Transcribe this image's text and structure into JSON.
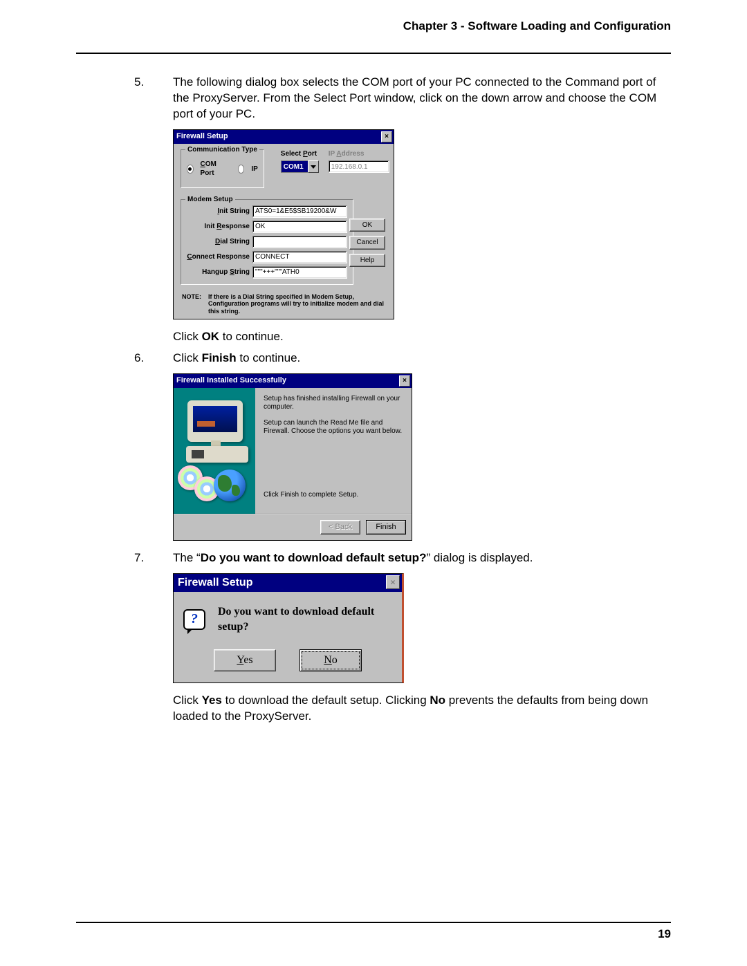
{
  "header": {
    "title": "Chapter 3 - Software Loading and Configuration"
  },
  "footer": {
    "page": "19"
  },
  "steps": {
    "s5": {
      "num": "5.",
      "text": "The following dialog box selects the COM port of your PC connected to the Command port of the ProxyServer. From the Select Port window, click on the down arrow and choose the COM port of your PC.",
      "after1_a": "Click ",
      "after1_b": "OK",
      "after1_c": " to continue."
    },
    "s6": {
      "num": "6.",
      "text_a": "Click ",
      "text_b": "Finish",
      "text_c": " to continue."
    },
    "s7": {
      "num": "7.",
      "text_a": "The “",
      "text_b": "Do you want to download default setup?",
      "text_c": "” dialog is displayed.",
      "after_a": "Click ",
      "after_b": "Yes",
      "after_c": " to download the default setup. Clicking ",
      "after_d": "No",
      "after_e": " prevents the defaults from being down loaded to the ProxyServer."
    }
  },
  "dlg1": {
    "title": "Firewall Setup",
    "close": "×",
    "commtype_legend": "Communication Type",
    "radio_com_pre": "C",
    "radio_com_post": "OM Port",
    "radio_ip": "IP",
    "selectport_pre": "Select ",
    "selectport_u": "P",
    "selectport_post": "ort",
    "ipaddr_pre": "IP ",
    "ipaddr_u": "A",
    "ipaddr_post": "ddress",
    "com_value": "COM1",
    "ip_value": "192.168.0.1",
    "modem_legend": "Modem Setup",
    "init_string_pre": "I",
    "init_string_post": "nit String",
    "init_string_val": "ATS0=1&E5$SB19200&W",
    "init_resp_pre": "Init ",
    "init_resp_u": "R",
    "init_resp_post": "esponse",
    "init_resp_val": "OK",
    "dial_pre": "D",
    "dial_post": "ial String",
    "dial_val": "",
    "conn_pre": "C",
    "conn_post": "onnect Response",
    "conn_val": "CONNECT",
    "hang_pre": "Hangup ",
    "hang_u": "S",
    "hang_post": "tring",
    "hang_val": "\"\"\"+++\"\"\"ATH0",
    "note_label": "NOTE:",
    "note_text": "If there is a Dial String specified in Modem Setup, Configuration programs will try to initialize modem and dial this string.",
    "btn_ok": "OK",
    "btn_cancel": "Cancel",
    "btn_help": "Help"
  },
  "dlg2": {
    "title": "Firewall Installed Successfully",
    "close": "×",
    "p1": "Setup has finished installing Firewall on your computer.",
    "p2": "Setup can launch the Read Me file and Firewall.  Choose the options you want below.",
    "p3": "Click Finish to complete Setup.",
    "btn_back": "< Back",
    "btn_finish": "Finish"
  },
  "dlg3": {
    "title": "Firewall Setup",
    "close": "×",
    "qmark": "?",
    "question": "Do you want to download default setup?",
    "yes_u": "Y",
    "yes_rest": "es",
    "no_u": "N",
    "no_rest": "o"
  }
}
